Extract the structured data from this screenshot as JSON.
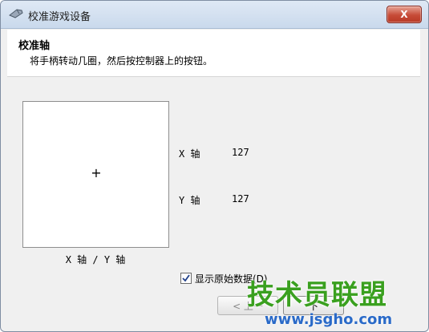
{
  "window": {
    "title": "校准游戏设备",
    "close_label": "X"
  },
  "header": {
    "title": "校准轴",
    "description": "将手柄转动几圈，然后按控制器上的按钮。"
  },
  "axis_display": {
    "crosshair": "+",
    "caption": "X 轴 / Y 轴"
  },
  "axes": [
    {
      "label": "X 轴",
      "value": "127"
    },
    {
      "label": "Y 轴",
      "value": "127"
    }
  ],
  "raw_data_checkbox": {
    "label": "显示原始数据(D)",
    "checked": true
  },
  "buttons": {
    "back": "< 上一",
    "next": "下"
  },
  "watermark": {
    "text": "技术员联盟",
    "url": "www.jsgho.com"
  }
}
